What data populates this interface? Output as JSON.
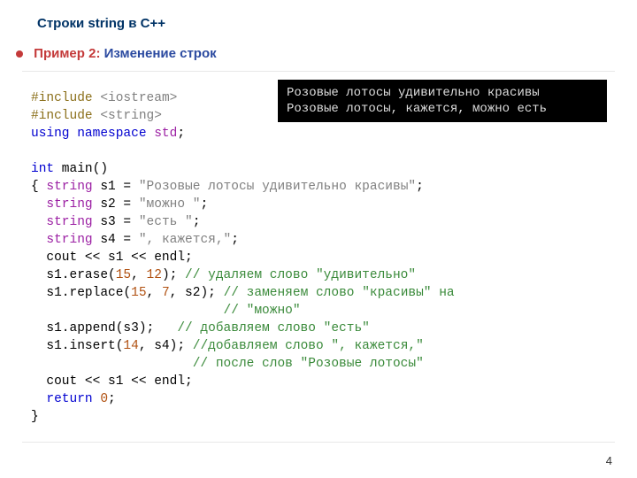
{
  "slide": {
    "title": "Строки  string в С++",
    "example_label": "Пример 2:",
    "example_subtitle": "Изменение строк",
    "page_number": "4"
  },
  "output": {
    "line1": "Розовые лотосы удивительно красивы",
    "line2": "Розовые лотосы, кажется, можно есть"
  },
  "code": {
    "pp1": "#include",
    "inc1": " <iostream>",
    "pp2": "#include",
    "inc2": " <string>",
    "using_kw": "using",
    "namespace_kw": " namespace",
    "std_ns": " std",
    "semi": ";",
    "int_kw": "int",
    "main_sig": " main()",
    "lbrace": "{ ",
    "string_kw": "string",
    "s1_decl": " s1 = ",
    "s1_val": "\"Розовые лотосы удивительно красивы\"",
    "s2_decl": " s2 = ",
    "s2_val": "\"можно \"",
    "s3_decl": " s3 = ",
    "s3_val": "\"есть \"",
    "s4_decl": " s4 = ",
    "s4_val": "\", кажется,\"",
    "cout1": "  cout << s1 << endl;",
    "erase_call": "  s1.erase(",
    "erase_a": "15",
    "erase_c": ", ",
    "erase_b": "12",
    "erase_end": "); ",
    "erase_cm": "// удаляем слово \"удивительно\"",
    "replace_call": "  s1.replace(",
    "replace_a": "15",
    "replace_c1": ", ",
    "replace_b": "7",
    "replace_end": ", s2); ",
    "replace_cm1": "// заменяем слово \"красивы\" на",
    "replace_cm2": "// \"можно\"",
    "append_call": "  s1.append(s3);   ",
    "append_cm": "// добавляем слово \"есть\"",
    "insert_call": "  s1.insert(",
    "insert_a": "14",
    "insert_end": ", s4); ",
    "insert_cm1": "//добавляем слово \", кажется,\"",
    "insert_cm2": "// после слов \"Розовые лотосы\"",
    "cout2": "  cout << s1 << endl;",
    "return_kw": "return",
    "return_rest": " ",
    "return_val": "0",
    "return_end": ";",
    "rbrace": "}"
  }
}
